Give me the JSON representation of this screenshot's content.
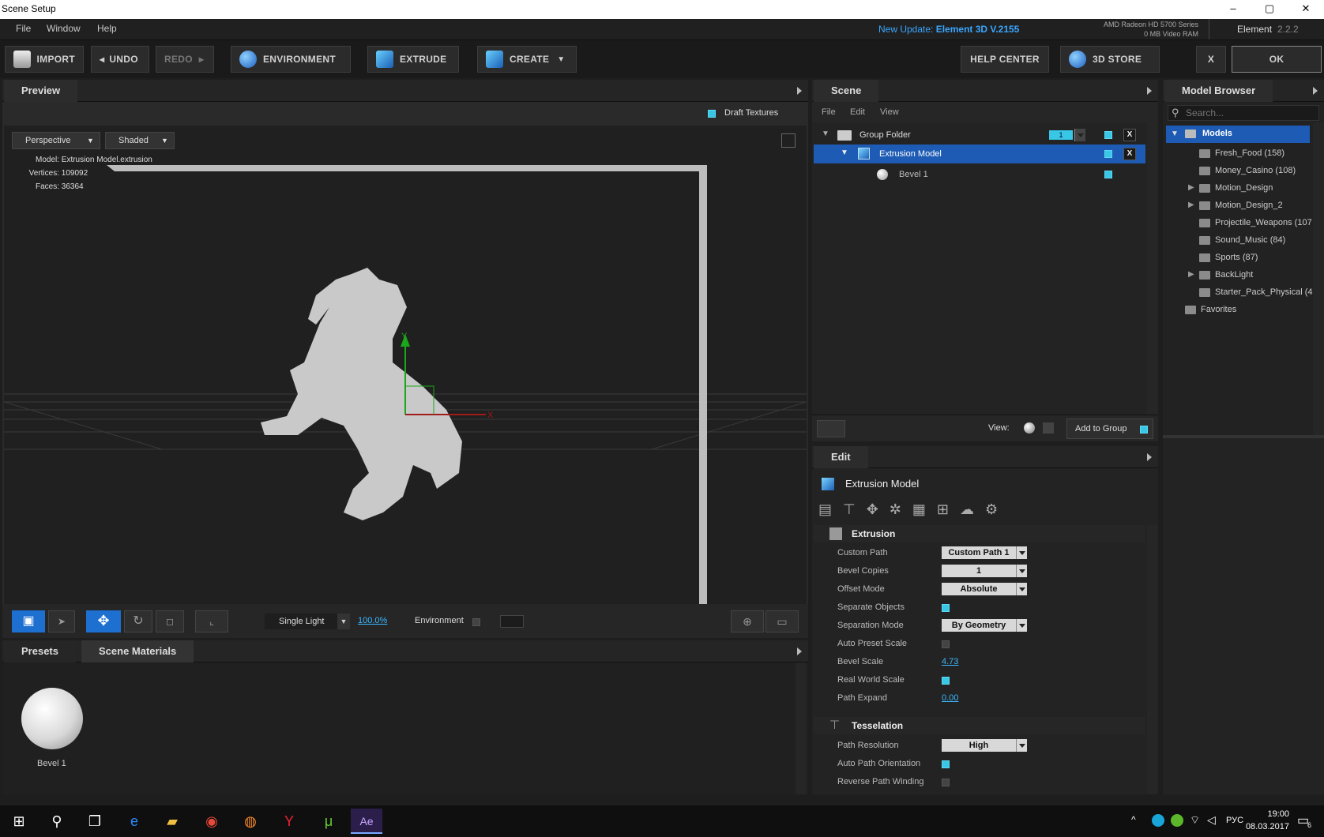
{
  "window": {
    "title": "Scene Setup",
    "minimize": "–",
    "restore": "▢",
    "close": "✕"
  },
  "menu": {
    "file": "File",
    "window": "Window",
    "help": "Help",
    "update_prefix": "New Update:",
    "update_version": "Element 3D V.2155",
    "gpu_name": "AMD Radeon HD 5700 Series",
    "gpu_ram": "0 MB Video RAM",
    "app_name": "Element",
    "app_version": "2.2.2"
  },
  "toolbar": {
    "import": "IMPORT",
    "undo": "UNDO",
    "redo": "REDO",
    "environment": "ENVIRONMENT",
    "extrude": "EXTRUDE",
    "create": "CREATE",
    "help_center": "HELP CENTER",
    "store": "3D STORE",
    "cancel": "X",
    "ok": "OK"
  },
  "preview": {
    "tab": "Preview",
    "draft_textures": "Draft Textures",
    "view_mode": "Perspective",
    "shade_mode": "Shaded",
    "model_label": "Model:",
    "model_value": "Extrusion Model.extrusion",
    "vertices_label": "Vertices:",
    "vertices_value": "109092",
    "faces_label": "Faces:",
    "faces_value": "36364",
    "axis_y": "Y",
    "axis_x": "X",
    "light": "Single Light",
    "zoom": "100.0%",
    "environment": "Environment"
  },
  "presets": {
    "tab_presets": "Presets",
    "tab_materials": "Scene Materials",
    "material_name": "Bevel 1"
  },
  "scene": {
    "tab": "Scene",
    "menu_file": "File",
    "menu_edit": "Edit",
    "menu_view": "View",
    "group_folder": "Group Folder",
    "group_number": "1",
    "model": "Extrusion Model",
    "bevel": "Bevel 1",
    "close_x": "X",
    "view_label": "View:",
    "add_to_group": "Add to Group"
  },
  "edit": {
    "tab": "Edit",
    "title": "Extrusion Model",
    "extrusion_section": "Extrusion",
    "props": [
      {
        "label": "Custom Path",
        "value": "Custom Path 1"
      },
      {
        "label": "Bevel Copies",
        "value": "1"
      },
      {
        "label": "Offset Mode",
        "value": "Absolute"
      },
      {
        "label": "Separate Objects"
      },
      {
        "label": "Separation Mode",
        "value": "By Geometry"
      },
      {
        "label": "Auto Preset Scale"
      },
      {
        "label": "Bevel Scale",
        "value": "4.73"
      },
      {
        "label": "Real World Scale"
      },
      {
        "label": "Path Expand",
        "value": "0.00"
      }
    ],
    "tess_section": "Tesselation",
    "tess_props": [
      {
        "label": "Path Resolution",
        "value": "High"
      },
      {
        "label": "Auto Path Orientation"
      },
      {
        "label": "Reverse Path Winding"
      }
    ]
  },
  "browser": {
    "tab": "Model Browser",
    "search_placeholder": "Search...",
    "root": "Models",
    "items": [
      "Fresh_Food (158)",
      "Money_Casino (108)",
      "Motion_Design",
      "Motion_Design_2",
      "Projectile_Weapons (107",
      "Sound_Music (84)",
      "Sports (87)",
      "BackLight",
      "Starter_Pack_Physical (4"
    ],
    "favorites": "Favorites"
  },
  "taskbar": {
    "lang": "РУС",
    "time": "19:00",
    "date": "08.03.2017",
    "notif_count": "6"
  },
  "colors": {
    "accent": "#38c7e6",
    "selection": "#1d5bb5",
    "update_link": "#3aa6ff"
  }
}
